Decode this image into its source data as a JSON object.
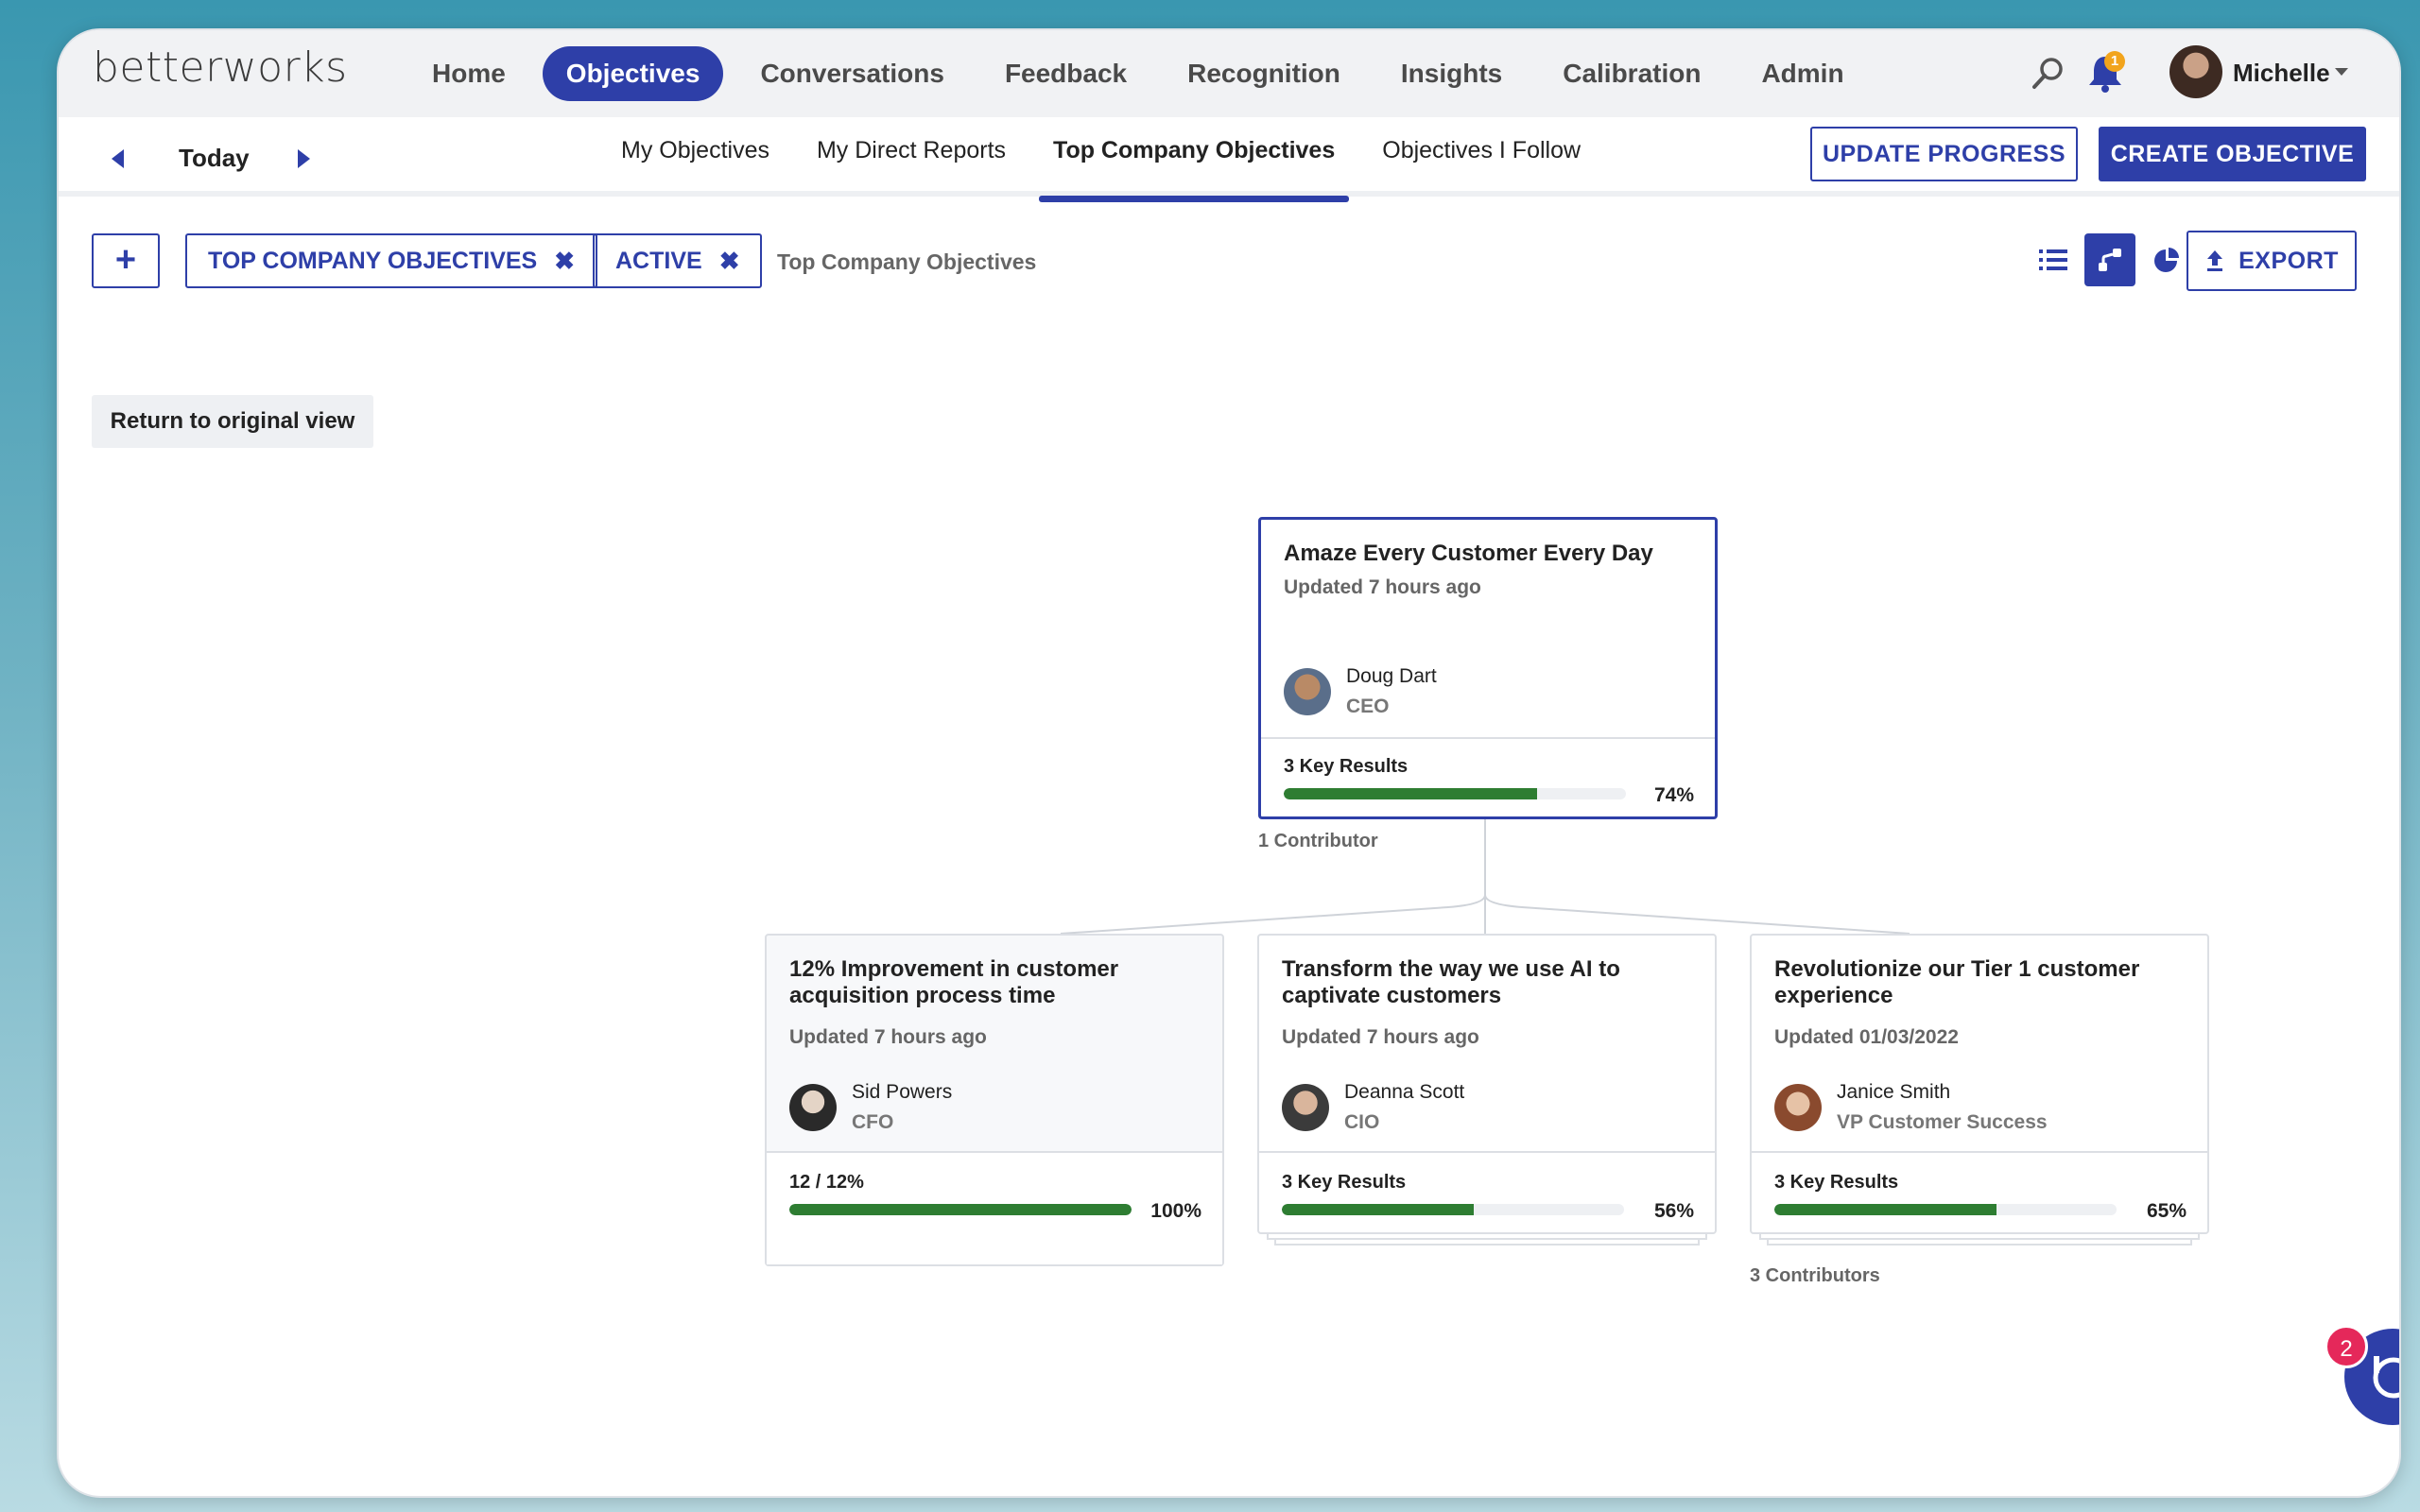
{
  "brand": {
    "logo_text": "betterworks",
    "accent": "#2e3fa8",
    "progress_color": "#2e7d32"
  },
  "mainnav": {
    "items": [
      "Home",
      "Objectives",
      "Conversations",
      "Feedback",
      "Recognition",
      "Insights",
      "Calibration",
      "Admin"
    ],
    "active": "Objectives"
  },
  "header": {
    "search_icon": "search-icon",
    "notifications": {
      "icon": "bell-icon",
      "count": "1"
    },
    "user": {
      "name": "Michelle"
    }
  },
  "subnav": {
    "period": "Today",
    "tabs": [
      "My Objectives",
      "My Direct Reports",
      "Top Company Objectives",
      "Objectives I Follow"
    ],
    "active_tab": "Top Company Objectives",
    "update_label": "UPDATE PROGRESS",
    "create_label": "CREATE OBJECTIVE"
  },
  "filters": {
    "add_symbol": "+",
    "chips": [
      "TOP COMPANY OBJECTIVES",
      "ACTIVE"
    ],
    "remove_symbol": "✖",
    "label": "Top Company Objectives",
    "export_label": "EXPORT",
    "view_icons": [
      "list-view-icon",
      "tree-view-icon",
      "pie-chart-icon"
    ]
  },
  "return_label": "Return to original view",
  "tree": {
    "root": {
      "title": "Amaze Every Customer Every Day",
      "updated": "Updated 7 hours ago",
      "owner": "Doug Dart",
      "role": "CEO",
      "kr_label": "3 Key Results",
      "progress": 0.74,
      "progress_text": "74%",
      "contributors": "1 Contributor"
    },
    "children": [
      {
        "title_line1": "12% Improvement in customer",
        "title_line2": "acquisition process time",
        "updated": "Updated 7 hours ago",
        "owner": "Sid Powers",
        "role": "CFO",
        "kr_label": "12 / 12%",
        "progress": 1.0,
        "progress_text": "100%"
      },
      {
        "title_line1": "Transform the way we use AI to",
        "title_line2": "captivate customers",
        "updated": "Updated 7 hours ago",
        "owner": "Deanna Scott",
        "role": "CIO",
        "kr_label": "3 Key Results",
        "progress": 0.56,
        "progress_text": "56%"
      },
      {
        "title_line1": "Revolutionize our Tier 1 customer",
        "title_line2": "experience",
        "updated": "Updated 01/03/2022",
        "owner": "Janice Smith",
        "role": "VP Customer Success",
        "kr_label": "3 Key Results",
        "progress": 0.65,
        "progress_text": "65%",
        "contributors": "3 Contributors"
      }
    ]
  },
  "help": {
    "badge": "2"
  }
}
